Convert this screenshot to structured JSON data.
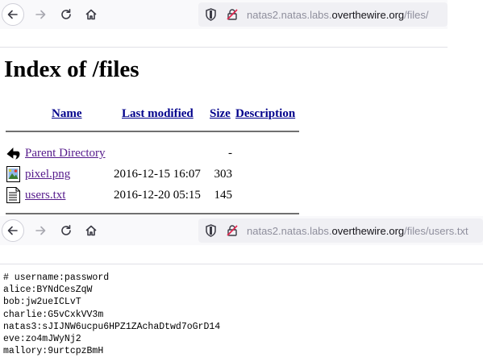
{
  "browser_top": {
    "url_prefix": "natas2.natas.",
    "url_light": "labs.",
    "url_domain": "overthewire.org",
    "url_path": "/files/"
  },
  "listing": {
    "title": "Index of /files",
    "columns": [
      "Name",
      "Last modified",
      "Size",
      "Description"
    ],
    "rows": [
      {
        "name": "Parent Directory",
        "modified": "",
        "size": "-",
        "icon": "back-arrow-icon"
      },
      {
        "name": "pixel.png",
        "modified": "2016-12-15 16:07",
        "size": "303",
        "icon": "image-file-icon"
      },
      {
        "name": "users.txt",
        "modified": "2016-12-20 05:15",
        "size": "145",
        "icon": "text-file-icon"
      }
    ]
  },
  "browser_bottom": {
    "url_prefix": "natas2.natas.",
    "url_light": "labs.",
    "url_domain": "overthewire.org",
    "url_path": "/files/users.txt"
  },
  "file_content": {
    "lines": [
      "# username:password",
      "alice:BYNdCesZqW",
      "bob:jw2ueICLvT",
      "charlie:G5vCxkVV3m",
      "natas3:sJIJNW6ucpu6HPZ1ZAchaDtwd7oGrD14",
      "eve:zo4mJWyNj2",
      "mallory:9urtcpzBmH"
    ]
  },
  "colors": {
    "link": "#00008b",
    "visited": "#551a8b",
    "toolbar": "#f9f9fb",
    "urlbar": "#f0f0f4"
  }
}
